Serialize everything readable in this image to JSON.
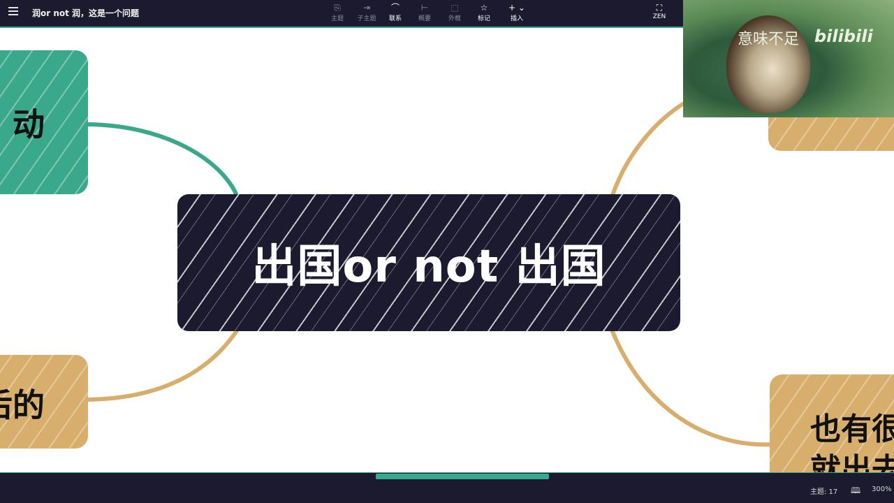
{
  "app": {
    "title": "润or not 润，这是一个问题"
  },
  "toolbar": {
    "items": [
      {
        "label": "主题",
        "icon": "topic-icon"
      },
      {
        "label": "子主题",
        "icon": "subtopic-icon"
      },
      {
        "label": "联系",
        "icon": "relationship-icon"
      },
      {
        "label": "概要",
        "icon": "summary-icon"
      },
      {
        "label": "外框",
        "icon": "boundary-icon"
      },
      {
        "label": "标记",
        "icon": "star-icon"
      },
      {
        "label": "插入",
        "icon": "plus-icon"
      }
    ],
    "zen_label": "ZEN"
  },
  "mindmap": {
    "central_topic": "出国or not 出国",
    "branches": [
      {
        "text": "动",
        "color": "#3aa88a"
      },
      {
        "text": "后的",
        "color": "#d8ae6c"
      },
      {
        "text": "",
        "color": "#d8ae6c"
      },
      {
        "text": "也有很\n就出去",
        "line1": "也有很",
        "line2": "就出去",
        "color": "#d8ae6c"
      }
    ]
  },
  "webcam": {
    "caption": "意味不足",
    "logo": "bilibili"
  },
  "status": {
    "topic_count": "主题: 17",
    "zoom": "300%"
  },
  "colors": {
    "toolbar_bg": "#1b1a2e",
    "accent_green": "#3aa88a",
    "accent_tan": "#d8ae6c",
    "central_bg": "#1b1a2e"
  }
}
